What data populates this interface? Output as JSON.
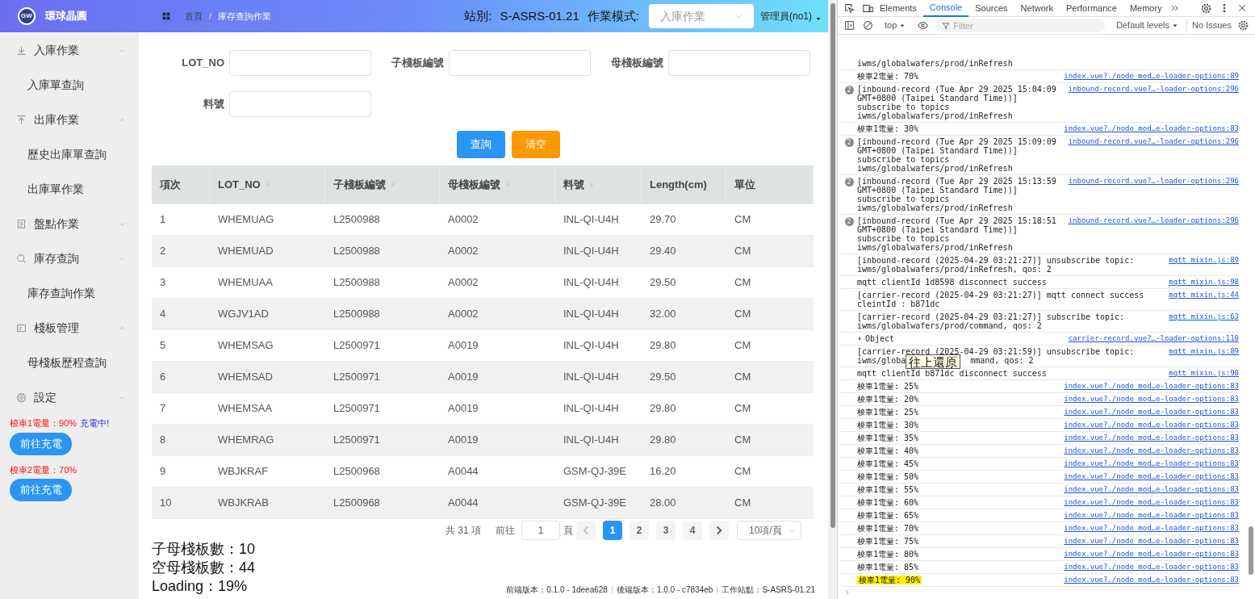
{
  "header": {
    "logo_text": "GW",
    "brand": "環球晶圓",
    "breadcrumb": [
      "首頁",
      "庫存查詢作業"
    ],
    "breadcrumb_separator": "/",
    "station_label": "站別:",
    "station": "S-ASRS-01.21",
    "mode_label": "作業模式:",
    "mode_value": "入庫作業",
    "user": "管理員(no1)"
  },
  "sidebar": {
    "groups": [
      {
        "label": "入庫作業",
        "kind": "download",
        "expanded": true,
        "children": [
          {
            "label": "入庫單查詢"
          }
        ]
      },
      {
        "label": "出庫作業",
        "kind": "upload",
        "expanded": true,
        "children": [
          {
            "label": "歷史出庫單查詢"
          },
          {
            "label": "出庫單作業"
          }
        ]
      },
      {
        "label": "盤點作業",
        "kind": "document",
        "expanded": false
      },
      {
        "label": "庫存查詢",
        "kind": "search",
        "expanded": true,
        "children": [
          {
            "label": "庫存查詢作業"
          }
        ]
      },
      {
        "label": "棧板管理",
        "kind": "card",
        "expanded": true,
        "children": [
          {
            "label": "母棧板歷程查詢"
          }
        ]
      },
      {
        "label": "設定",
        "kind": "gear",
        "expanded": false
      }
    ],
    "shuttles": [
      {
        "status": "梭車1電量：90%",
        "charging": "充電中!",
        "button": "前往充電"
      },
      {
        "status": "梭車2電量：70%",
        "button": "前往充電"
      }
    ]
  },
  "form": {
    "fields": [
      {
        "label": "LOT_NO"
      },
      {
        "label": "子棧板編號"
      },
      {
        "label": "母棧板編號"
      },
      {
        "label": "料號"
      }
    ],
    "buttons": [
      {
        "label": "查詢",
        "kind": "primary"
      },
      {
        "label": "清空",
        "kind": "warning"
      }
    ]
  },
  "table": {
    "columns": [
      {
        "label": "項次",
        "sortable": false
      },
      {
        "label": "LOT_NO",
        "sortable": true
      },
      {
        "label": "子棧板編號",
        "sortable": true
      },
      {
        "label": "母棧板編號",
        "sortable": true
      },
      {
        "label": "料號",
        "sortable": true
      },
      {
        "label": "Length(cm)",
        "sortable": false
      },
      {
        "label": "單位",
        "sortable": false
      }
    ],
    "rows": [
      [
        "1",
        "WHEMUAG",
        "L2500988",
        "A0002",
        "INL-QI-U4H",
        "29.70",
        "CM"
      ],
      [
        "2",
        "WHEMUAD",
        "L2500988",
        "A0002",
        "INL-QI-U4H",
        "29.40",
        "CM"
      ],
      [
        "3",
        "WHEMUAA",
        "L2500988",
        "A0002",
        "INL-QI-U4H",
        "29.50",
        "CM"
      ],
      [
        "4",
        "WGJV1AD",
        "L2500988",
        "A0002",
        "INL-QI-U4H",
        "32.00",
        "CM"
      ],
      [
        "5",
        "WHEMSAG",
        "L2500971",
        "A0019",
        "INL-QI-U4H",
        "29.80",
        "CM"
      ],
      [
        "6",
        "WHEMSAD",
        "L2500971",
        "A0019",
        "INL-QI-U4H",
        "29.50",
        "CM"
      ],
      [
        "7",
        "WHEMSAA",
        "L2500971",
        "A0019",
        "INL-QI-U4H",
        "29.80",
        "CM"
      ],
      [
        "8",
        "WHEMRAG",
        "L2500971",
        "A0019",
        "INL-QI-U4H",
        "29.80",
        "CM"
      ],
      [
        "9",
        "WBJKRAF",
        "L2500968",
        "A0044",
        "GSM-QJ-39E",
        "16.20",
        "CM"
      ],
      [
        "10",
        "WBJKRAB",
        "L2500968",
        "A0044",
        "GSM-QJ-39E",
        "28.00",
        "CM"
      ]
    ]
  },
  "pagination": {
    "total": "共 31 項",
    "goto_label": "前往",
    "page_value": "1",
    "page_suffix": "頁",
    "pages": [
      {
        "label": "1",
        "selected": true
      },
      {
        "label": "2",
        "selected": false
      },
      {
        "label": "3",
        "selected": false
      },
      {
        "label": "4",
        "selected": false
      }
    ],
    "page_size": "10項/頁"
  },
  "summary": [
    "子母棧板數：10",
    "空母棧板數：44",
    "Loading：19%"
  ],
  "footer": [
    "前端版本：0.1.0 - 1deea628",
    "後端版本：1.0.0 - c7834eb",
    "工作站點：S-ASRS-01.21"
  ],
  "devtools": {
    "tabs": [
      {
        "label": "Elements",
        "selected": false
      },
      {
        "label": "Console",
        "selected": true
      },
      {
        "label": "Sources",
        "selected": false
      },
      {
        "label": "Network",
        "selected": false
      },
      {
        "label": "Performance",
        "selected": false
      },
      {
        "label": "Memory",
        "selected": false
      }
    ],
    "context": "top",
    "filter_placeholder": "Filter",
    "levels": "Default levels",
    "issues": "No Issues",
    "messages": [
      {
        "kind": "log",
        "text": "iwms/globalwafers/prod/inRefresh"
      },
      {
        "kind": "log",
        "text": "梭車2電量: 70%",
        "source": "index.vue?./node_mod…e-loader-options:89"
      },
      {
        "kind": "log",
        "count": "2",
        "text": "[inbound-record (Tue Apr 29 2025 15:04:09 GMT+0800 (Taipei Standard Time))] subscribe to topics iwms/globalwafers/prod/inRefresh",
        "source": "inbound-record.vue?…-loader-options:296"
      },
      {
        "kind": "log",
        "text": "梭車1電量: 30%",
        "source": "index.vue?./node_mod…e-loader-options:83"
      },
      {
        "kind": "log",
        "count": "2",
        "text": "[inbound-record (Tue Apr 29 2025 15:09:09 GMT+0800 (Taipei Standard Time))] subscribe to topics iwms/globalwafers/prod/inRefresh",
        "source": "inbound-record.vue?…-loader-options:296"
      },
      {
        "kind": "log",
        "count": "2",
        "text": "[inbound-record (Tue Apr 29 2025 15:13:59 GMT+0800 (Taipei Standard Time))] subscribe to topics iwms/globalwafers/prod/inRefresh",
        "source": "inbound-record.vue?…-loader-options:296"
      },
      {
        "kind": "log",
        "count": "2",
        "text": "[inbound-record (Tue Apr 29 2025 15:18:51 GMT+0800 (Taipei Standard Time))] subscribe to topics iwms/globalwafers/prod/inRefresh",
        "source": "inbound-record.vue?…-loader-options:296"
      },
      {
        "kind": "log",
        "text": "[inbound-record (2025-04-29 03:21:27)] unsubscribe topic: iwms/globalwafers/prod/inRefresh, qos: 2",
        "source": "mqtt_mixin.js:89"
      },
      {
        "kind": "log",
        "text": "mqtt clientId 1d8598 disconnect success",
        "source": "mqtt_mixin.js:98"
      },
      {
        "kind": "log",
        "text": "[carrier-record (2025-04-29 03:21:27)] mqtt connect success cleintId : b871dc",
        "source": "mqtt_mixin.js:44"
      },
      {
        "kind": "log",
        "text": "[carrier-record (2025-04-29 03:21:27)] subscribe topic: iwms/globalwafers/prod/command, qos: 2",
        "source": "mqtt_mixin.js:63"
      },
      {
        "kind": "object",
        "text": "Object",
        "source": "carrier-record.vue?…-loader-options:110"
      },
      {
        "kind": "covered",
        "text": "[carrier-record (2025-04-29 03:21:59)] unsubscribe topic:",
        "covered_line": [
          "iwms/globa",
          "mmand, qos: 2"
        ],
        "source": "mqtt_mixin.js:89"
      },
      {
        "kind": "log",
        "text": "mqtt clientId b871dc disconnect success",
        "source": "mqtt_mixin.js:98"
      },
      {
        "kind": "log",
        "text": "梭車1電量: 25%",
        "source": "index.vue?./node_mod…e-loader-options:83"
      },
      {
        "kind": "log",
        "text": "梭車1電量: 20%",
        "source": "index.vue?./node_mod…e-loader-options:83"
      },
      {
        "kind": "log",
        "text": "梭車1電量: 25%",
        "source": "index.vue?./node_mod…e-loader-options:83"
      },
      {
        "kind": "log",
        "text": "梭車1電量: 30%",
        "source": "index.vue?./node_mod…e-loader-options:83"
      },
      {
        "kind": "log",
        "text": "梭車1電量: 35%",
        "source": "index.vue?./node_mod…e-loader-options:83"
      },
      {
        "kind": "log",
        "text": "梭車1電量: 40%",
        "source": "index.vue?./node_mod…e-loader-options:83"
      },
      {
        "kind": "log",
        "text": "梭車1電量: 45%",
        "source": "index.vue?./node_mod…e-loader-options:83"
      },
      {
        "kind": "log",
        "text": "梭車1電量: 50%",
        "source": "index.vue?./node_mod…e-loader-options:83"
      },
      {
        "kind": "log",
        "text": "梭車1電量: 55%",
        "source": "index.vue?./node_mod…e-loader-options:83"
      },
      {
        "kind": "log",
        "text": "梭車1電量: 60%",
        "source": "index.vue?./node_mod…e-loader-options:83"
      },
      {
        "kind": "log",
        "text": "梭車1電量: 65%",
        "source": "index.vue?./node_mod…e-loader-options:83"
      },
      {
        "kind": "log",
        "text": "梭車1電量: 70%",
        "source": "index.vue?./node_mod…e-loader-options:83"
      },
      {
        "kind": "log",
        "text": "梭車1電量: 75%",
        "source": "index.vue?./node_mod…e-loader-options:83"
      },
      {
        "kind": "log",
        "text": "梭車1電量: 80%",
        "source": "index.vue?./node_mod…e-loader-options:83"
      },
      {
        "kind": "log",
        "text": "梭車1電量: 85%",
        "source": "index.vue?./node_mod…e-loader-options:83"
      },
      {
        "kind": "log",
        "text": "梭車1電量: 90%",
        "source": "index.vue?./node_mod…e-loader-options:83",
        "highlighted": true
      }
    ],
    "tooltip": "往上還原"
  }
}
